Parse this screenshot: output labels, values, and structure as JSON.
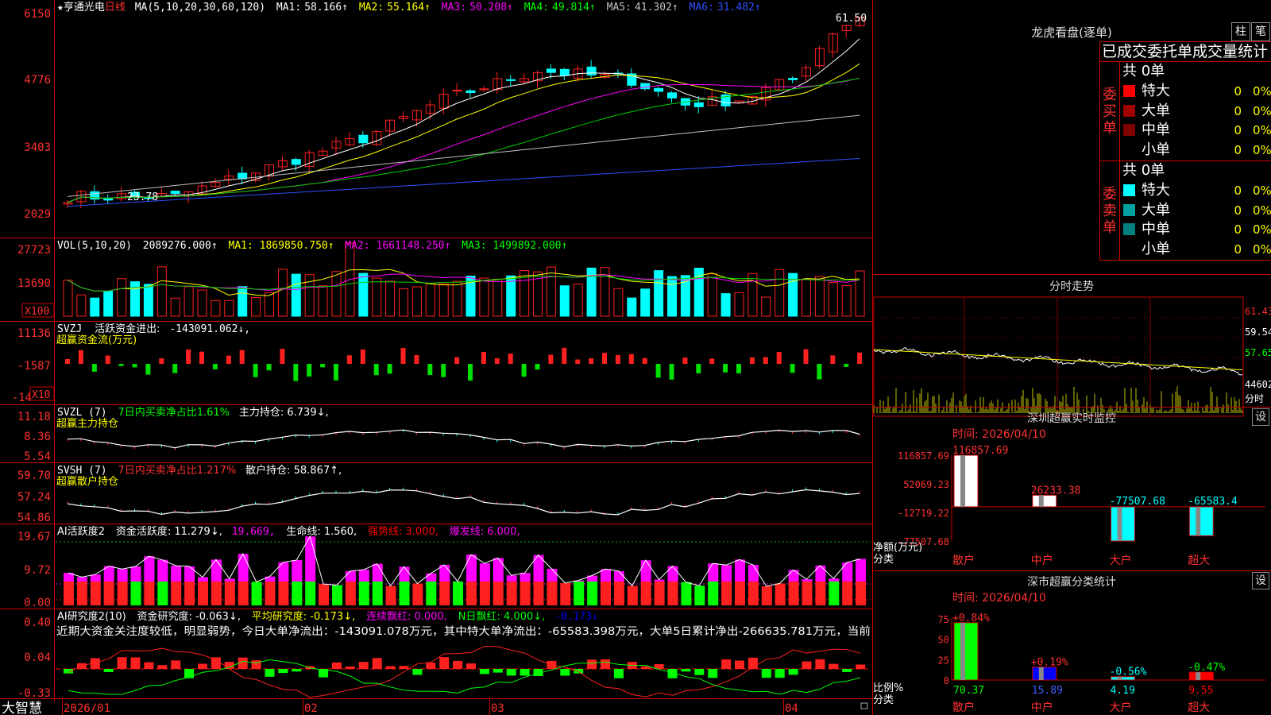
{
  "header": {
    "star": "★",
    "name": "亨通光电",
    "period": "日线",
    "ma_params": "MA(5,10,20,30,60,120)",
    "ma": [
      {
        "label": "MA1:",
        "value": "58.166↑",
        "color": "#ffffff"
      },
      {
        "label": "MA2:",
        "value": "55.164↑",
        "color": "#ffff00"
      },
      {
        "label": "MA3:",
        "value": "50.208↑",
        "color": "#ff00ff"
      },
      {
        "label": "MA4:",
        "value": "49.814↑",
        "color": "#00ff00"
      },
      {
        "label": "MA5:",
        "value": "41.302↑",
        "color": "#c0c0c0"
      },
      {
        "label": "MA6:",
        "value": "31.482↑",
        "color": "#0000ff"
      }
    ],
    "price_ticks": [
      "6150",
      "4776",
      "3403",
      "2029"
    ],
    "hi_label": "61.50",
    "lo_label": "23.78"
  },
  "vol": {
    "title": "VOL(5,10,20)",
    "value": "2089276.000↑",
    "ma1": "MA1: 1869850.750↑",
    "ma2": "MA2: 1661148.250↑",
    "ma3": "MA3: 1499892.000↑",
    "ticks": [
      "27723",
      "13690"
    ],
    "unit": "X100"
  },
  "svzj": {
    "title": "SVZJ",
    "label": "活跃资金进出:",
    "value": "-143091.062↓,",
    "subtitle": "超赢资金流(万元)",
    "ticks": [
      "11136",
      "-1587",
      "-14"
    ],
    "unit": "X10"
  },
  "svzl": {
    "title": "SVZL (7)",
    "ratio": "7日内买卖净占比1.61%",
    "hold": "主力持仓: 6.739↓,",
    "subtitle": "超赢主力持仓",
    "ticks": [
      "11.18",
      "8.36",
      "5.54"
    ]
  },
  "svsh": {
    "title": "SVSH (7)",
    "ratio": "7日内买卖净占比1.217%",
    "hold": "散户持仓: 58.867↑,",
    "subtitle": "超赢散户持仓",
    "ticks": [
      "59.70",
      "57.24",
      "54.86"
    ]
  },
  "ai1": {
    "title": "AI活跃度2",
    "l1": "资金活跃度: 11.279↓,",
    "v2": "19.669,",
    "l3": "生命线: 1.560,",
    "l4": "强势线: 3.000,",
    "l5": "爆发线: 6.000,",
    "ticks": [
      "19.67",
      "9.72",
      "0.00"
    ]
  },
  "ai2": {
    "title": "AI研究度2(10)",
    "l1": "资金研究度: -0.063↓,",
    "l2": "平均研究度: -0.173↓,",
    "l3": "连续飘红: 0.000,",
    "l4": "N日飘红: 4.000↓,",
    "l5": "-0.173↓",
    "desc": "近期大资金关注度较低，明显弱势，今日大单净流出：-143091.078万元，其中特大单净流出：-65583.398万元，大单5日累计净出-266635.781万元，当前",
    "ticks": [
      "0.40",
      "0.04",
      "-0.33"
    ]
  },
  "xaxis": {
    "logo": "大智慧",
    "labels": [
      "2026/01",
      "02",
      "03",
      "04"
    ]
  },
  "lhb": {
    "title": "龙虎看盘(逐单)",
    "btn1": "柱",
    "btn2": "笔",
    "tabs": "已成交委托单成交量统计",
    "buy": {
      "label": "委买单",
      "header": "共 0单",
      "rows": [
        {
          "name": "特大",
          "color": "#ff0000",
          "count": "0",
          "pct": "0%"
        },
        {
          "name": "大单",
          "color": "#a00000",
          "count": "0",
          "pct": "0%"
        },
        {
          "name": "中单",
          "color": "#800000",
          "count": "0",
          "pct": "0%"
        },
        {
          "name": "小单",
          "color": "#000000",
          "count": "0",
          "pct": "0%"
        }
      ]
    },
    "sell": {
      "label": "委卖单",
      "header": "共 0单",
      "rows": [
        {
          "name": "特大",
          "color": "#00ffff",
          "count": "0",
          "pct": "0%"
        },
        {
          "name": "大单",
          "color": "#00a0a0",
          "count": "0",
          "pct": "0%"
        },
        {
          "name": "中单",
          "color": "#008080",
          "count": "0",
          "pct": "0%"
        },
        {
          "name": "小单",
          "color": "#000000",
          "count": "0",
          "pct": "0%"
        }
      ]
    }
  },
  "fenshi": {
    "title": "分时走势",
    "ticks": [
      "61.43",
      "59.54",
      "57.65"
    ],
    "vol_label": "44602",
    "unit": "分时"
  },
  "sz_monitor": {
    "title": "深圳超赢实时监控",
    "gear": "设",
    "time": "时间: 2026/04/10",
    "ticks": [
      "116857.69",
      "52069.23",
      "-12719.22",
      "-77507.68"
    ],
    "ylabel1": "净额(万元)",
    "ylabel2": "分类"
  },
  "sz_stats": {
    "title": "深市超赢分类统计",
    "gear": "设",
    "time": "时间: 2026/04/10",
    "ticks": [
      "75",
      "50",
      "25",
      "0"
    ],
    "ylabel1": "比例%",
    "ylabel2": "分类"
  },
  "chart_data": [
    {
      "type": "bar",
      "title": "深圳超赢实时监控",
      "categories": [
        "散户",
        "中户",
        "大户",
        "超大"
      ],
      "values": [
        116857.69,
        26233.38,
        -77507.68,
        -65583.4
      ],
      "labels": [
        "116857.69",
        "26233.38",
        "-77507.68",
        "-65583.4"
      ],
      "ylim": [
        -77507.68,
        116857.69
      ],
      "colors": [
        "#ffffff",
        "#ffffff",
        "#00ffff",
        "#00ffff"
      ]
    },
    {
      "type": "bar",
      "title": "深市超赢分类统计",
      "categories": [
        "散户",
        "中户",
        "大户",
        "超大"
      ],
      "values": [
        70.37,
        15.89,
        4.19,
        9.55
      ],
      "changes": [
        "+0.84%",
        "+0.19%",
        "-0.56%",
        "-0.47%"
      ],
      "ylim": [
        0,
        75
      ],
      "colors": [
        "#00ff00",
        "#0000ff",
        "#00ffff",
        "#ff0000"
      ]
    }
  ]
}
